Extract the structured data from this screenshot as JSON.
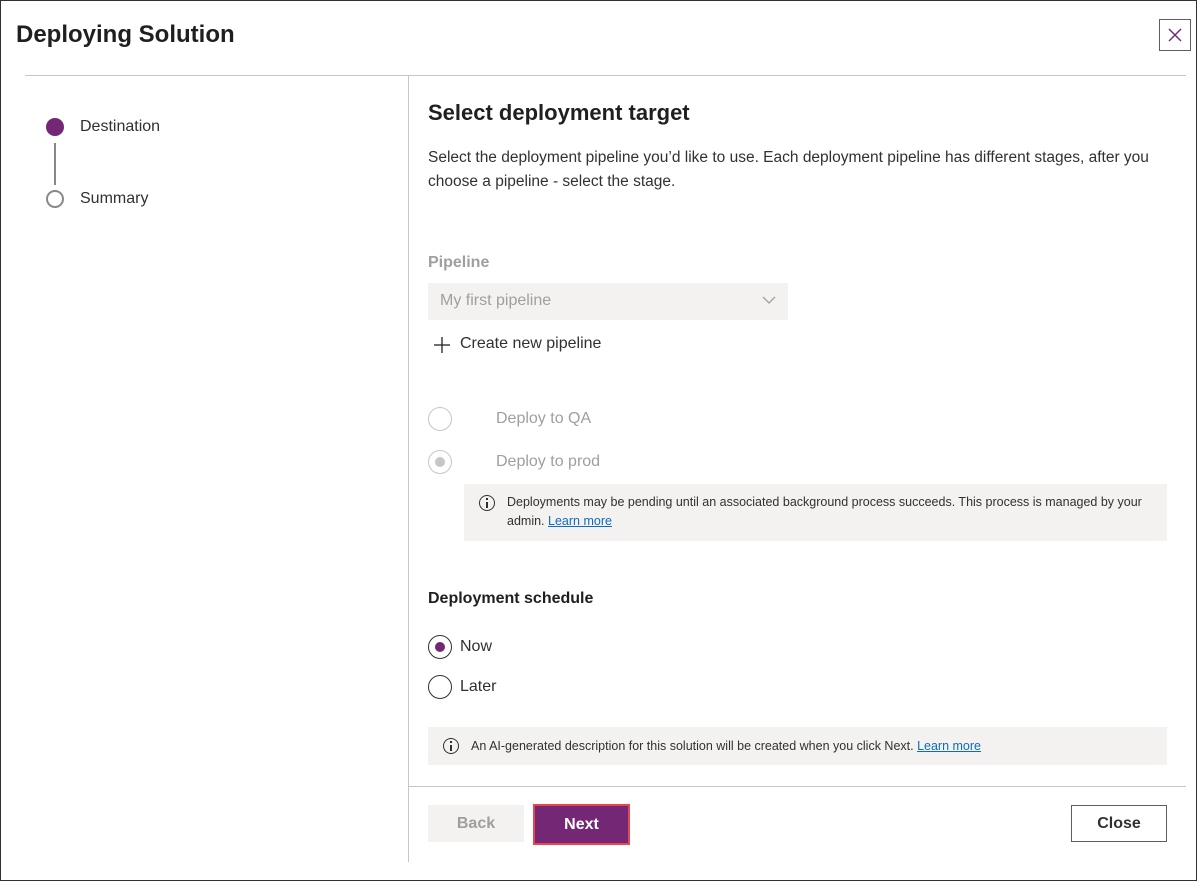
{
  "dialog": {
    "title": "Deploying Solution",
    "close_icon": "close-icon"
  },
  "steps": [
    {
      "label": "Destination",
      "state": "active"
    },
    {
      "label": "Summary",
      "state": "inactive"
    }
  ],
  "colors": {
    "accent": "#742774",
    "next_border": "#e8464d",
    "link": "#0f6cbd",
    "muted": "#a19f9d"
  },
  "main": {
    "heading": "Select deployment target",
    "description": "Select the deployment pipeline you’d like to use. Each deployment pipeline has different stages, after you choose a pipeline - select the stage.",
    "pipeline_label": "Pipeline",
    "pipeline_value": "My first pipeline",
    "create_pipeline_label": "Create new pipeline",
    "stages": [
      {
        "label": "Deploy to QA",
        "checked": false,
        "disabled": true
      },
      {
        "label": "Deploy to prod",
        "checked": true,
        "disabled": true
      }
    ],
    "pending_notice": {
      "text": "Deployments may be pending until an associated background process succeeds. This process is managed by your admin.",
      "link": "Learn more"
    },
    "schedule_label": "Deployment schedule",
    "schedule_options": [
      {
        "label": "Now",
        "checked": true
      },
      {
        "label": "Later",
        "checked": false
      }
    ],
    "ai_notice": {
      "text": "An AI-generated description for this solution will be created when you click Next.",
      "link": "Learn more"
    }
  },
  "footer": {
    "back_label": "Back",
    "next_label": "Next",
    "close_label": "Close"
  }
}
